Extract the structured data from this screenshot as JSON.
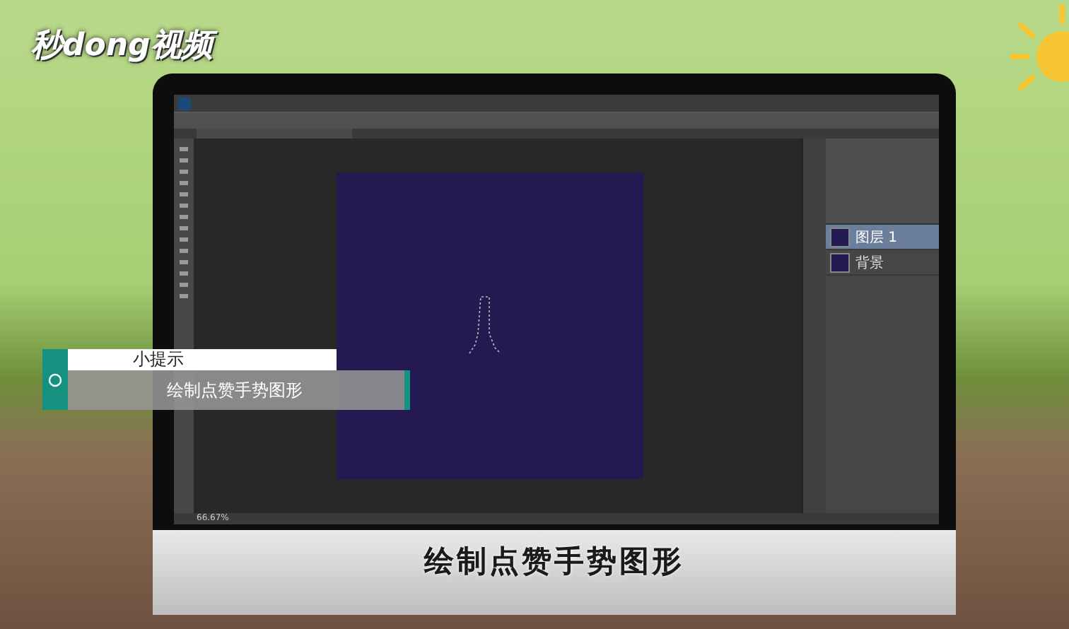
{
  "logo": {
    "text": "秒dong视频"
  },
  "layers": [
    {
      "name": "图层 1",
      "selected": true
    },
    {
      "name": "背景",
      "selected": false
    }
  ],
  "status": {
    "zoom": "66.67%"
  },
  "tip": {
    "title": "小提示",
    "text": "绘制点赞手势图形"
  },
  "caption": "绘制点赞手势图形"
}
